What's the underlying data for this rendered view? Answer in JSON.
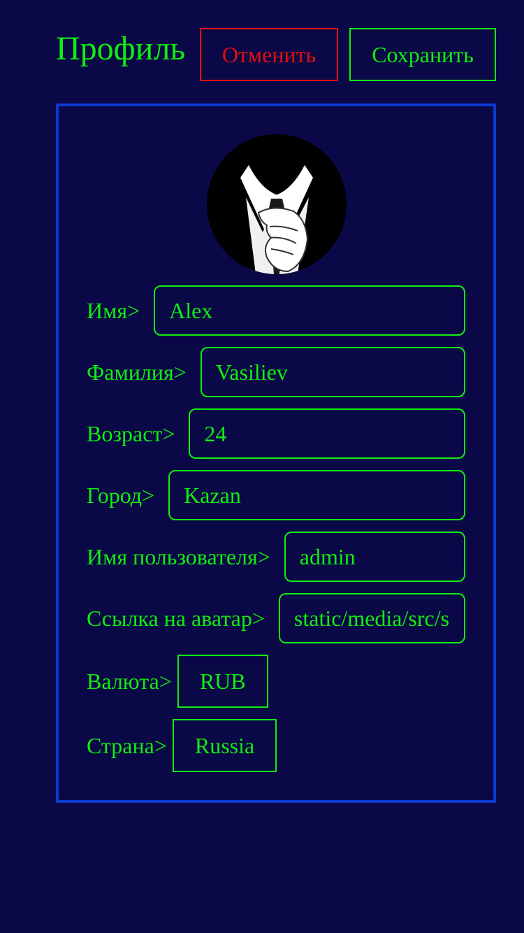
{
  "header": {
    "title": "Профиль",
    "cancel_label": "Отменить",
    "save_label": "Сохранить"
  },
  "profile": {
    "avatar_icon": "anonymous-suit-avatar",
    "fields": {
      "first_name": {
        "label": "Имя>",
        "value": "Alex"
      },
      "last_name": {
        "label": "Фамилия>",
        "value": "Vasiliev"
      },
      "age": {
        "label": "Возраст>",
        "value": "24"
      },
      "city": {
        "label": "Город>",
        "value": "Kazan"
      },
      "username": {
        "label": "Имя пользователя>",
        "value": "admin"
      },
      "avatar_link": {
        "label": "Ссылка на аватар>",
        "value": "static/media/src/s"
      },
      "currency": {
        "label": "Валюта>",
        "value": "RUB"
      },
      "country": {
        "label": "Страна>",
        "value": "Russia"
      }
    }
  },
  "colors": {
    "background": "#0a0846",
    "accent_green": "#10ee10",
    "cancel_red": "#e01010",
    "card_border": "#0a3ad0"
  }
}
